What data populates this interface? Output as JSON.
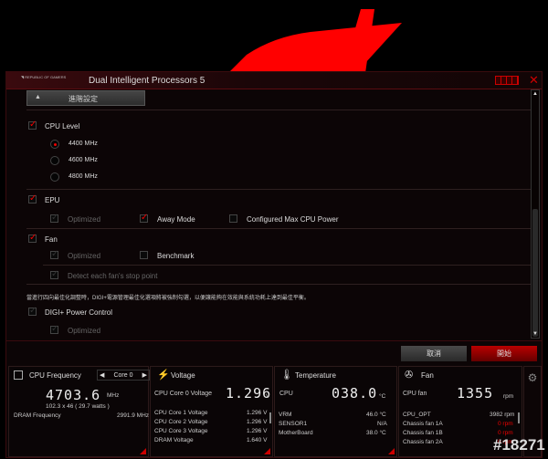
{
  "window": {
    "logo": "REPUBLIC OF GAMERS",
    "title": "Dual Intelligent Processors 5",
    "close_icon": "close-icon"
  },
  "section": {
    "title": "進階設定"
  },
  "cpu_level": {
    "label": "CPU Level",
    "options": [
      "4400 MHz",
      "4600 MHz",
      "4800 MHz"
    ],
    "selected": "4400 MHz",
    "checked": true
  },
  "epu": {
    "label": "EPU",
    "checked": true,
    "optimized": "Optimized",
    "away_mode": "Away Mode",
    "away_checked": true,
    "max_power": "Configured Max CPU Power",
    "max_power_checked": false
  },
  "fan": {
    "label": "Fan",
    "checked": true,
    "optimized": "Optimized",
    "benchmark": "Benchmark",
    "benchmark_checked": false,
    "detect": "Detect each fan's stop point"
  },
  "note": "當進行四向最佳化調整時，DIGI+電源管理最佳化選項將被強制勾選，以便讓能夠在效能與系統功耗上達到最佳平衡。",
  "digi": {
    "label": "DIGI+ Power Control",
    "optimized": "Optimized"
  },
  "buttons": {
    "cancel": "取消",
    "start": "開始"
  },
  "cpu_freq": {
    "title": "CPU Frequency",
    "core": "Core 0",
    "value": "4703.6",
    "unit": "MHz",
    "detail": "102.3  x  46  ( 29.7   watts )",
    "dram_label": "DRAM Frequency",
    "dram_value": "2991.9  MHz"
  },
  "voltage": {
    "title": "Voltage",
    "main_label": "CPU Core 0 Voltage",
    "main_value": "1.296",
    "unit": "V",
    "rows": [
      [
        "CPU Core 1 Voltage",
        "1.296  V"
      ],
      [
        "CPU Core 2 Voltage",
        "1.296  V"
      ],
      [
        "CPU Core 3 Voltage",
        "1.296  V"
      ],
      [
        "DRAM Voltage",
        "1.640  V"
      ]
    ]
  },
  "temperature": {
    "title": "Temperature",
    "main_label": "CPU",
    "main_value": "038.0",
    "unit": "°C",
    "rows": [
      [
        "VRM",
        "46.0 °C"
      ],
      [
        "SENSOR1",
        "N/A"
      ],
      [
        "MotherBoard",
        "38.0 °C"
      ]
    ]
  },
  "fan_panel": {
    "title": "Fan",
    "main_label": "CPU fan",
    "main_value": "1355",
    "unit": "rpm",
    "rows": [
      [
        "CPU_OPT",
        "3982  rpm"
      ],
      [
        "Chassis fan 1A",
        "0  rpm"
      ],
      [
        "Chassis fan 1B",
        "0  rpm"
      ],
      [
        "Chassis fan 2A",
        "0  rpm"
      ]
    ]
  },
  "watermark": "#18271",
  "colors": {
    "accent": "#e00000",
    "background": "#0c0506"
  }
}
